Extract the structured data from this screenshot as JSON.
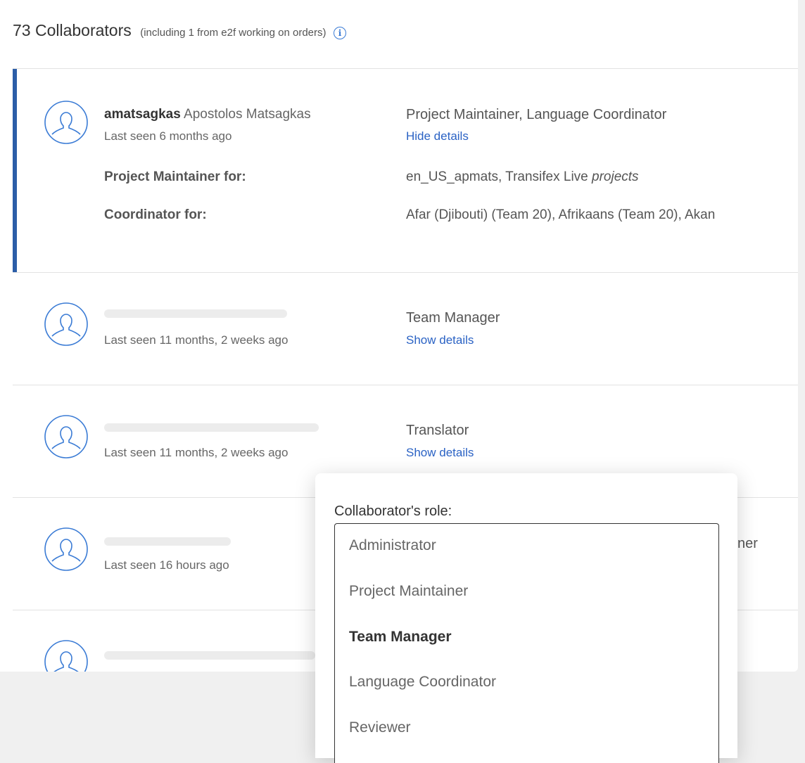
{
  "header": {
    "count_label": "73 Collaborators",
    "subtitle": "(including 1 from e2f working on orders)",
    "info_icon": "info-icon"
  },
  "collaborators": [
    {
      "username": "amatsagkas",
      "full_name": "Apostolos Matsagkas",
      "last_seen": "Last seen 6 months ago",
      "role": "Project Maintainer, Language Coordinator",
      "details_link": "Hide details",
      "details": {
        "maintainer_label": "Project Maintainer for:",
        "maintainer_value": "en_US_apmats, Transifex Live",
        "maintainer_suffix": "projects",
        "coordinator_label": "Coordinator for:",
        "coordinator_value": "Afar (Djibouti) (Team 20), Afrikaans (Team 20), Akan"
      }
    },
    {
      "last_seen": "Last seen 11 months, 2 weeks ago",
      "role": "Team Manager",
      "details_link": "Show details"
    },
    {
      "last_seen": "Last seen 11 months, 2 weeks ago",
      "role": "Translator",
      "details_link": "Show details"
    },
    {
      "last_seen": "Last seen 16 hours ago",
      "role_partial": "ner"
    }
  ],
  "role_popover": {
    "label": "Collaborator's role:",
    "options": [
      "Administrator",
      "Project Maintainer",
      "Team Manager",
      "Language Coordinator",
      "Reviewer"
    ],
    "selected": "Team Manager"
  },
  "colors": {
    "accent": "#2c5ea8",
    "link": "#2a62c4",
    "avatar_stroke": "#3a7bd5"
  }
}
